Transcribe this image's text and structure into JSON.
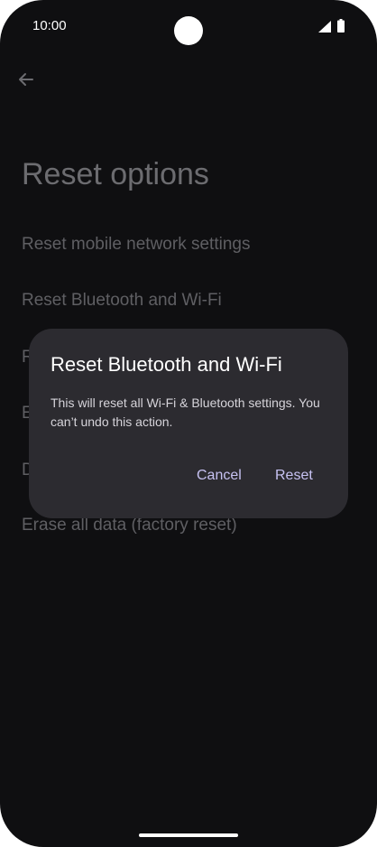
{
  "status_bar": {
    "time": "10:00",
    "icons": [
      "signal-icon",
      "battery-icon"
    ]
  },
  "header": {
    "back_icon": "arrow-left-icon",
    "title": "Reset options"
  },
  "options": [
    {
      "label": "Reset mobile network settings"
    },
    {
      "label": "Reset Bluetooth and Wi-Fi"
    },
    {
      "label": "R"
    },
    {
      "label": "E"
    },
    {
      "label": "D"
    },
    {
      "label": "Erase all data (factory reset)"
    }
  ],
  "dialog": {
    "title": "Reset Bluetooth and Wi-Fi",
    "message": "This will reset all Wi-Fi & Bluetooth settings. You can’t undo this action.",
    "cancel_label": "Cancel",
    "confirm_label": "Reset",
    "accent_color": "#c7c2f2",
    "surface_color": "#2c2b30"
  },
  "colors": {
    "background": "#0f0f11",
    "dimmed_text": "#5f5f63"
  }
}
